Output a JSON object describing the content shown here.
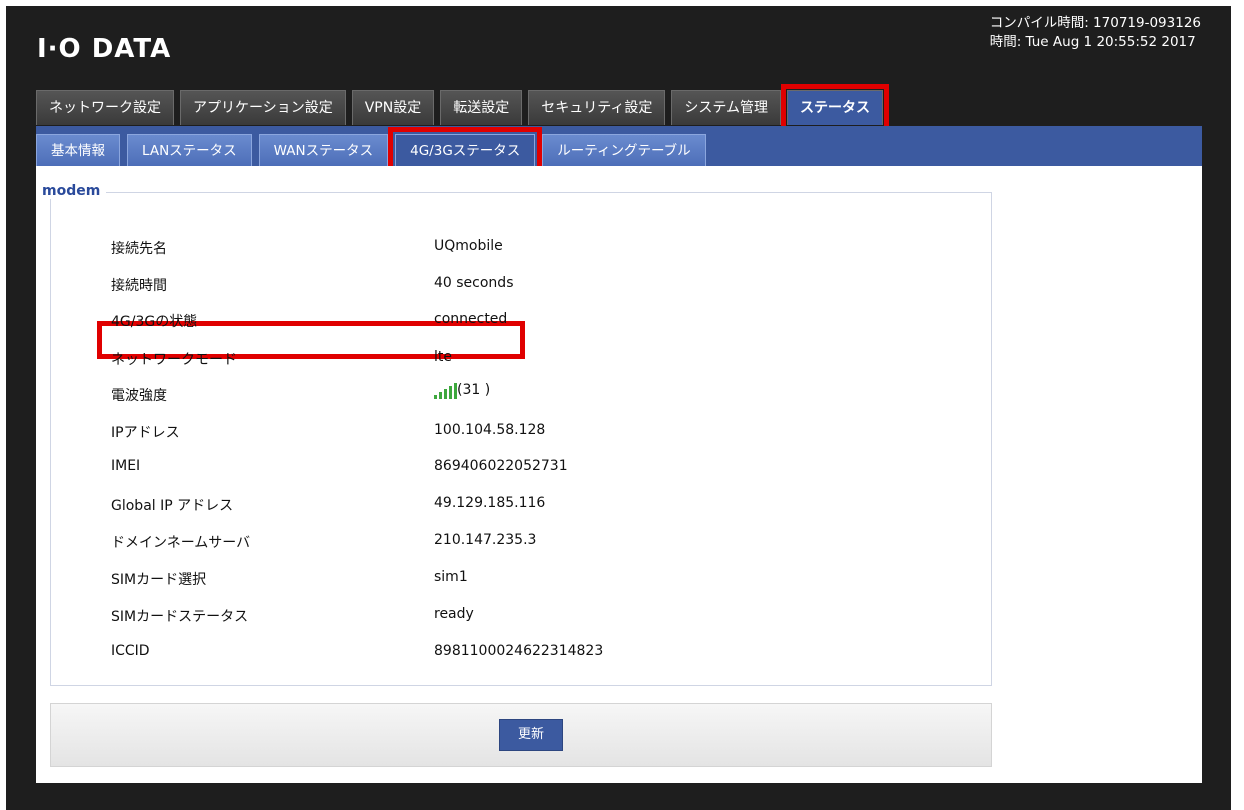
{
  "header": {
    "logo": "I·O DATA",
    "compile_time": "コンパイル時間: 170719-093126",
    "time": "時間: Tue Aug 1 20:55:52 2017"
  },
  "main_tabs": [
    {
      "label": "ネットワーク設定"
    },
    {
      "label": "アプリケーション設定"
    },
    {
      "label": "VPN設定"
    },
    {
      "label": "転送設定"
    },
    {
      "label": "セキュリティ設定"
    },
    {
      "label": "システム管理"
    },
    {
      "label": "ステータス",
      "active": true
    }
  ],
  "sub_tabs": [
    {
      "label": "基本情報"
    },
    {
      "label": "LANステータス"
    },
    {
      "label": "WANステータス"
    },
    {
      "label": "4G/3Gステータス",
      "active": true
    },
    {
      "label": "ルーティングテーブル"
    }
  ],
  "modem": {
    "legend": "modem",
    "rows": [
      {
        "label": "接続先名",
        "value": "UQmobile"
      },
      {
        "label": "接続時間",
        "value": "40 seconds"
      },
      {
        "label": "4G/3Gの状態",
        "value": "connected"
      },
      {
        "label": "ネットワークモード",
        "value": "lte"
      },
      {
        "label": "電波強度",
        "value": "(31 )"
      },
      {
        "label": "IPアドレス",
        "value": "100.104.58.128"
      },
      {
        "label": "IMEI",
        "value": "869406022052731"
      },
      {
        "label": "Global IP アドレス",
        "value": "49.129.185.116"
      },
      {
        "label": "ドメインネームサーバ",
        "value": "210.147.235.3"
      },
      {
        "label": "SIMカード選択",
        "value": "sim1"
      },
      {
        "label": "SIMカードステータス",
        "value": "ready"
      },
      {
        "label": "ICCID",
        "value": "8981100024622314823"
      }
    ]
  },
  "actions": {
    "refresh": "更新"
  },
  "colors": {
    "accent": "#3c5aa0",
    "highlight": "#e00000",
    "signal": "#3ea83e"
  },
  "icons": {
    "signal": "signal-strength-icon"
  }
}
